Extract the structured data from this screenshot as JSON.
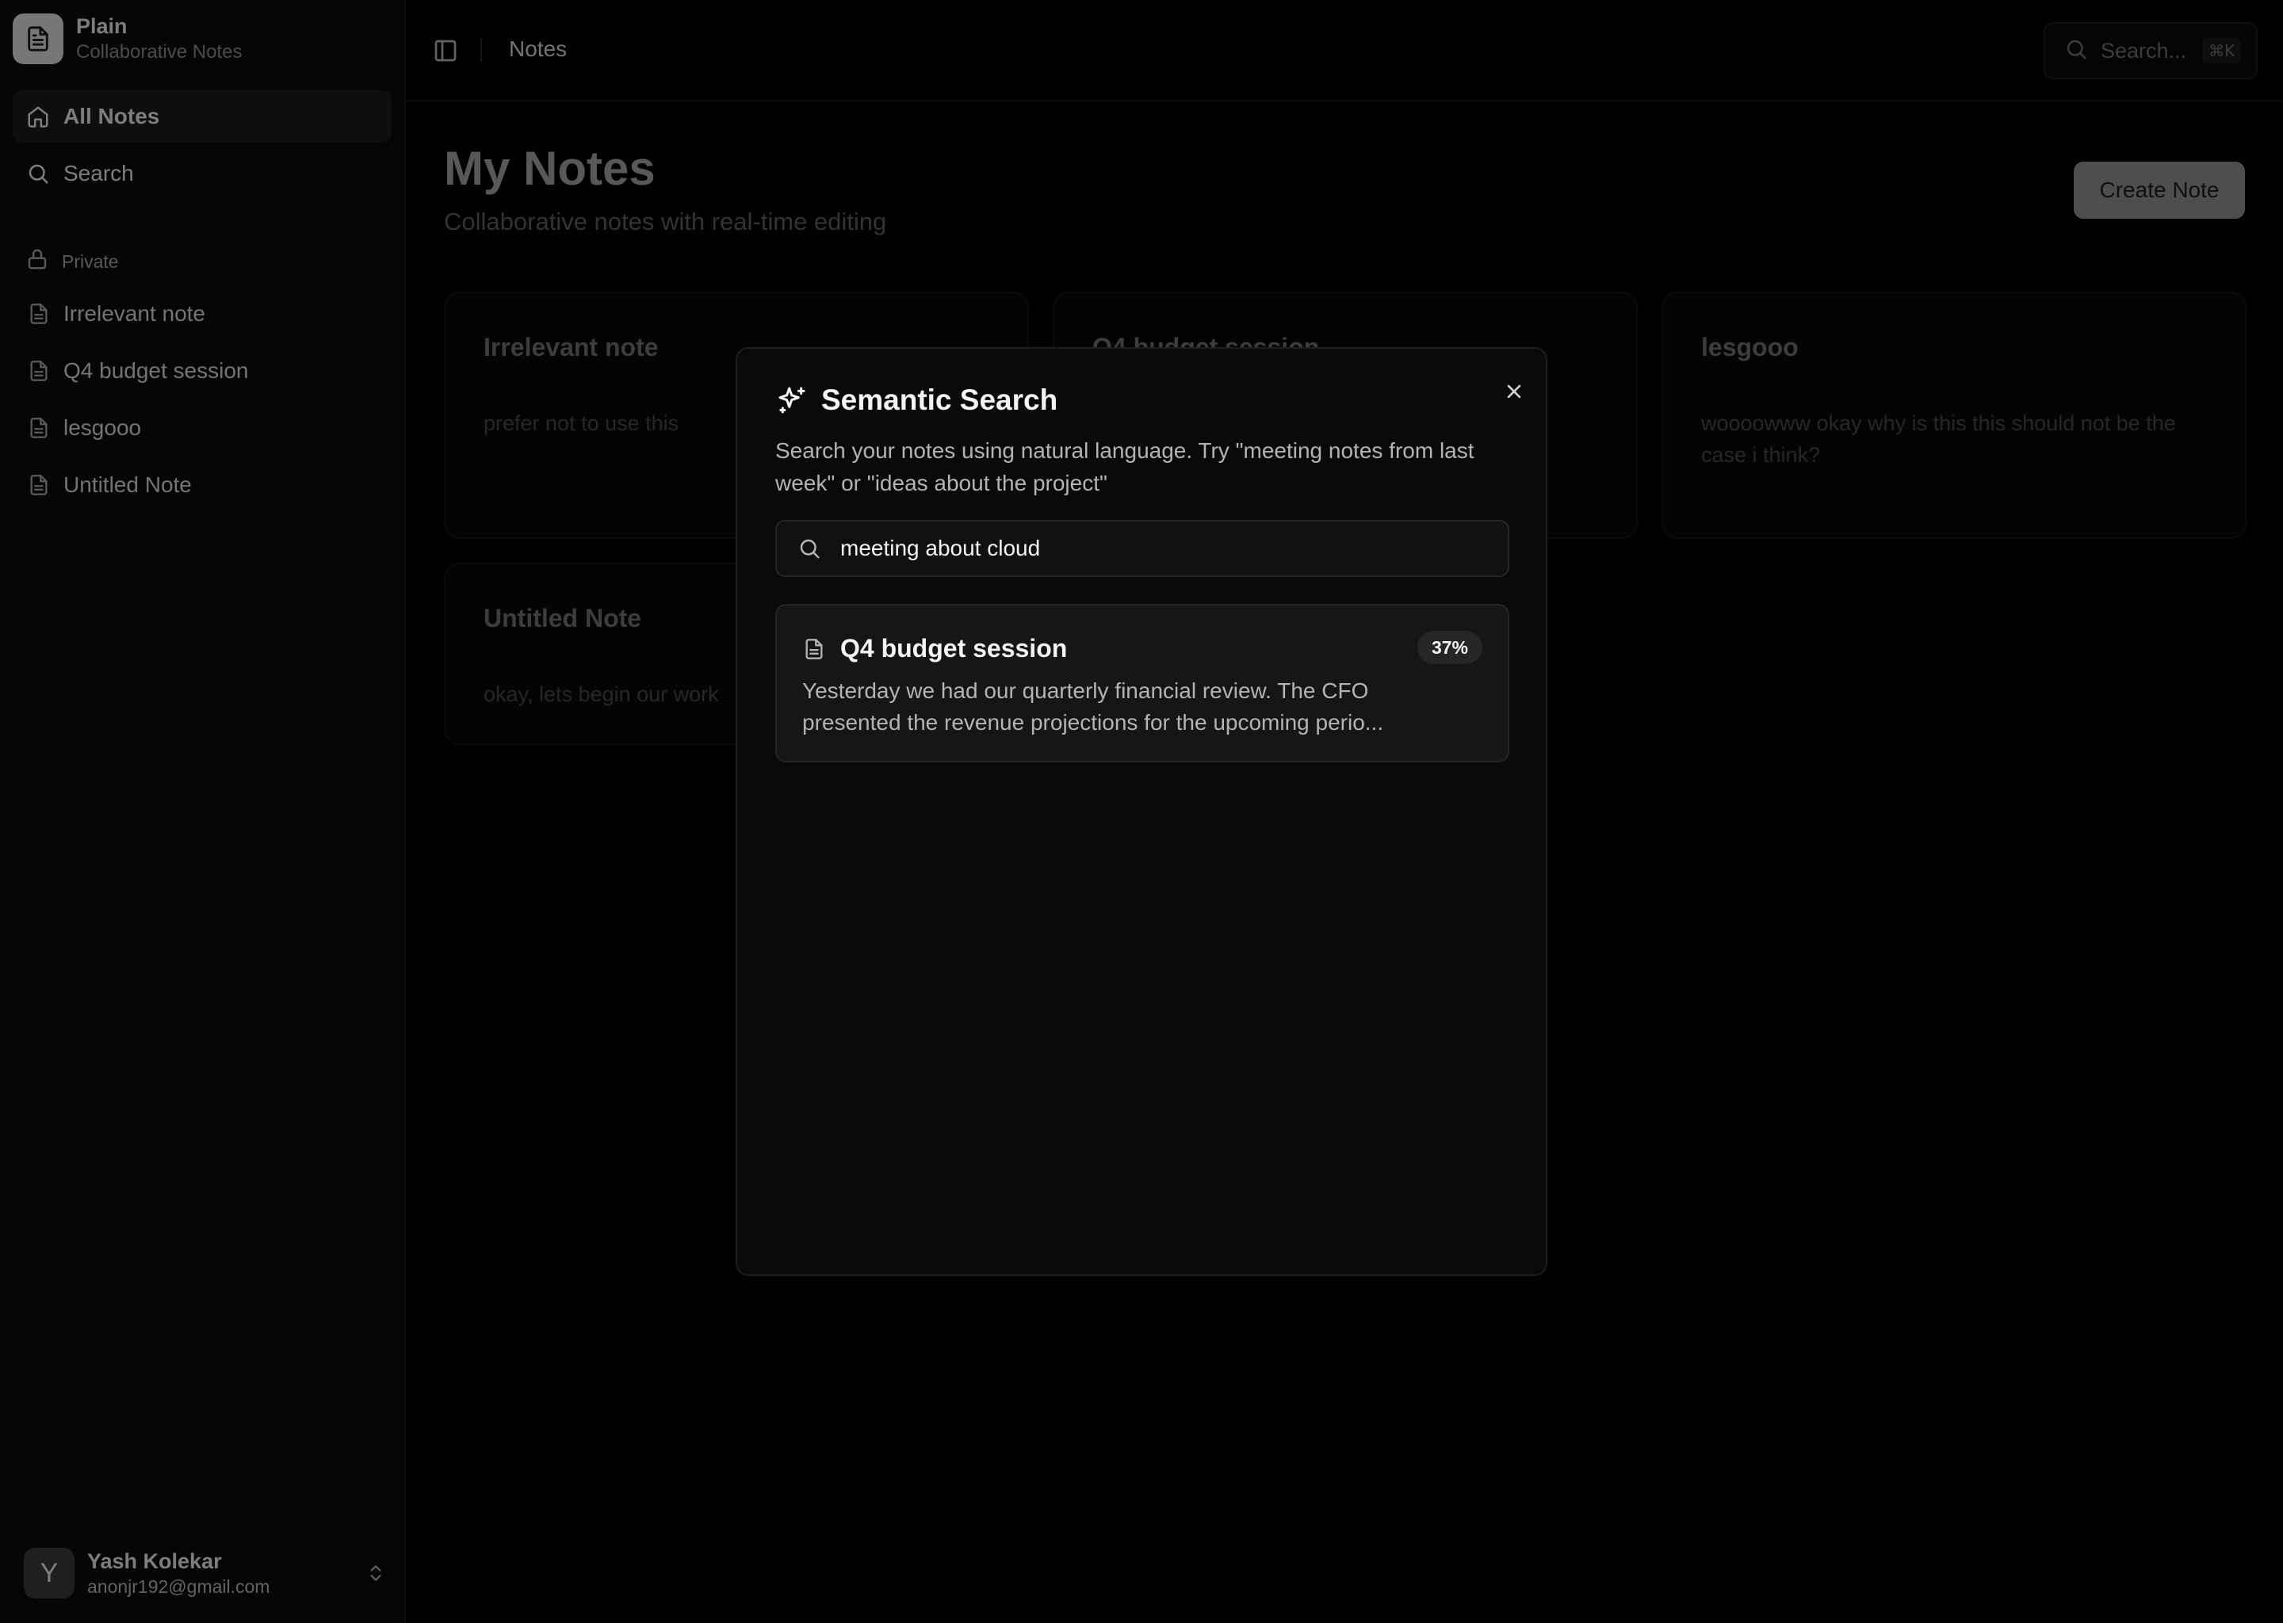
{
  "app": {
    "name": "Plain",
    "subtitle": "Collaborative Notes"
  },
  "sidebar": {
    "nav": [
      {
        "label": "All Notes",
        "icon": "home-icon",
        "active": true
      },
      {
        "label": "Search",
        "icon": "search-icon",
        "active": false
      }
    ],
    "section_label": "Private",
    "notes": [
      {
        "label": "Irrelevant note"
      },
      {
        "label": "Q4 budget session"
      },
      {
        "label": "lesgooo"
      },
      {
        "label": "Untitled Note"
      }
    ],
    "user": {
      "initial": "Y",
      "name": "Yash Kolekar",
      "email": "anonjr192@gmail.com"
    }
  },
  "header": {
    "breadcrumb": "Notes",
    "search_placeholder": "Search...",
    "search_shortcut": "⌘K"
  },
  "main": {
    "title": "My Notes",
    "subtitle": "Collaborative notes with real-time editing",
    "create_button": "Create Note",
    "cards": [
      {
        "title": "Irrelevant note",
        "body": "prefer not to use this"
      },
      {
        "title": "Q4 budget session",
        "body": ""
      },
      {
        "title": "lesgooo",
        "body": "woooowww okay why is this this should not be the case i think?"
      },
      {
        "title": "Untitled Note",
        "body": "okay, lets begin our work"
      }
    ]
  },
  "modal": {
    "title": "Semantic Search",
    "description": "Search your notes using natural language. Try \"meeting notes from last week\" or \"ideas about the project\"",
    "query": "meeting about cloud",
    "results": [
      {
        "title": "Q4 budget session",
        "score": "37%",
        "snippet": "Yesterday we had our quarterly financial review. The CFO presented the revenue projections for the upcoming perio..."
      }
    ]
  },
  "colors": {
    "background": "#000000",
    "sidebar": "#0c0c0c",
    "modal": "#0a0a0a",
    "accent_button": "#8f8f8f"
  }
}
